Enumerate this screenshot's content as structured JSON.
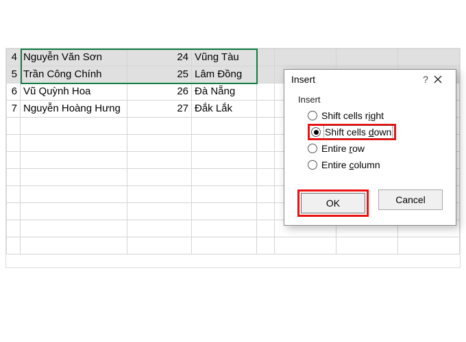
{
  "rows": [
    {
      "idx": "4",
      "name": "Nguyễn Văn Sơn",
      "num": "24",
      "loc": "Vũng Tàu",
      "selected": true
    },
    {
      "idx": "5",
      "name": "Trần Công Chính",
      "num": "25",
      "loc": "Lâm Đồng",
      "selected": true
    },
    {
      "idx": "6",
      "name": "Vũ Quỳnh Hoa",
      "num": "26",
      "loc": "Đà Nẵng",
      "selected": false
    },
    {
      "idx": "7",
      "name": "Nguyễn Hoàng Hưng",
      "num": "27",
      "loc": "Đắk Lắk",
      "selected": false
    }
  ],
  "blank_rows": 8,
  "dialog": {
    "title": "Insert",
    "help_symbol": "?",
    "group_label": "Insert",
    "options": {
      "right": {
        "pre": "Shift cells r",
        "ul": "i",
        "post": "ght"
      },
      "down": {
        "pre": "Shift cells ",
        "ul": "d",
        "post": "own"
      },
      "row": {
        "pre": "Entire ",
        "ul": "r",
        "post": "ow"
      },
      "column": {
        "pre": "Entire ",
        "ul": "c",
        "post": "olumn"
      }
    },
    "selected_option": "down",
    "ok_label": "OK",
    "cancel_label": "Cancel"
  }
}
